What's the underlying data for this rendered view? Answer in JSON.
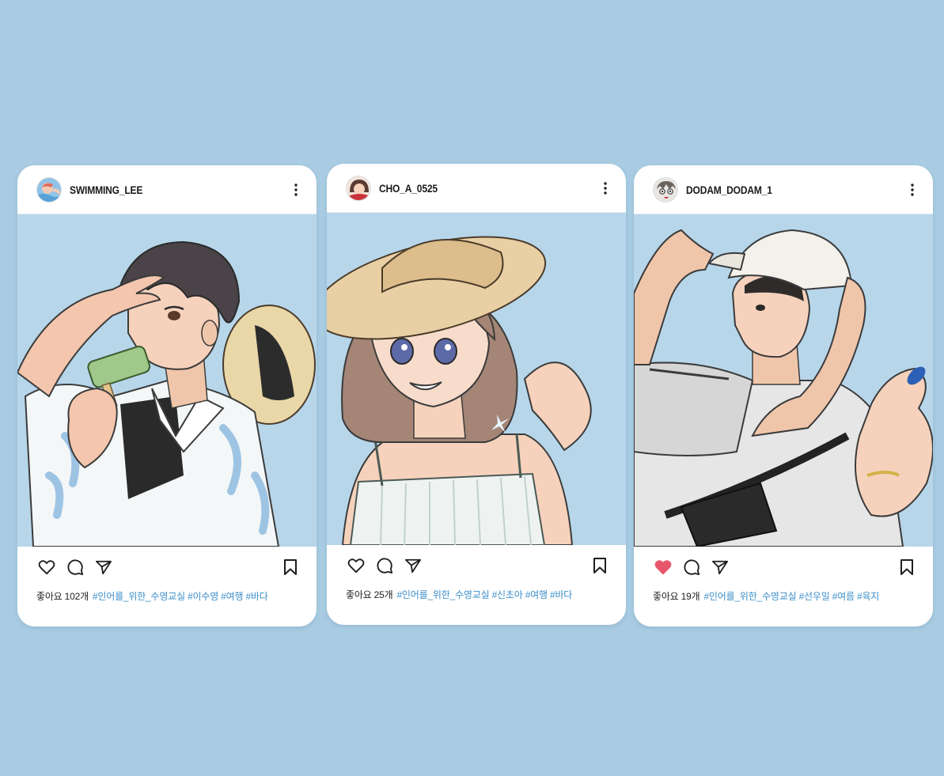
{
  "accent_color": "#3d8fc9",
  "liked_color": "#e8566b",
  "posts": [
    {
      "username": "SWIMMING_LEE",
      "likes": "좋아요 102개",
      "hashtags": "#인어를_위한_수영교실 #이수영 #여행 #바다",
      "liked": false,
      "avatar_icon": "swimmer-avatar"
    },
    {
      "username": "CHO_A_0525",
      "likes": "좋아요 25개",
      "hashtags": "#인어를_위한_수영교실 #신초아 #여행 #바다",
      "liked": false,
      "avatar_icon": "girl-avatar"
    },
    {
      "username": "DODAM_DODAM_1",
      "likes": "좋아요 19개",
      "hashtags": "#인어를_위한_수영교실 #선우일 #여름 #육지",
      "liked": true,
      "avatar_icon": "character-avatar"
    }
  ],
  "icons": {
    "more": "more-options-icon",
    "like": "heart-icon",
    "comment": "comment-icon",
    "share": "share-icon",
    "save": "bookmark-icon"
  }
}
